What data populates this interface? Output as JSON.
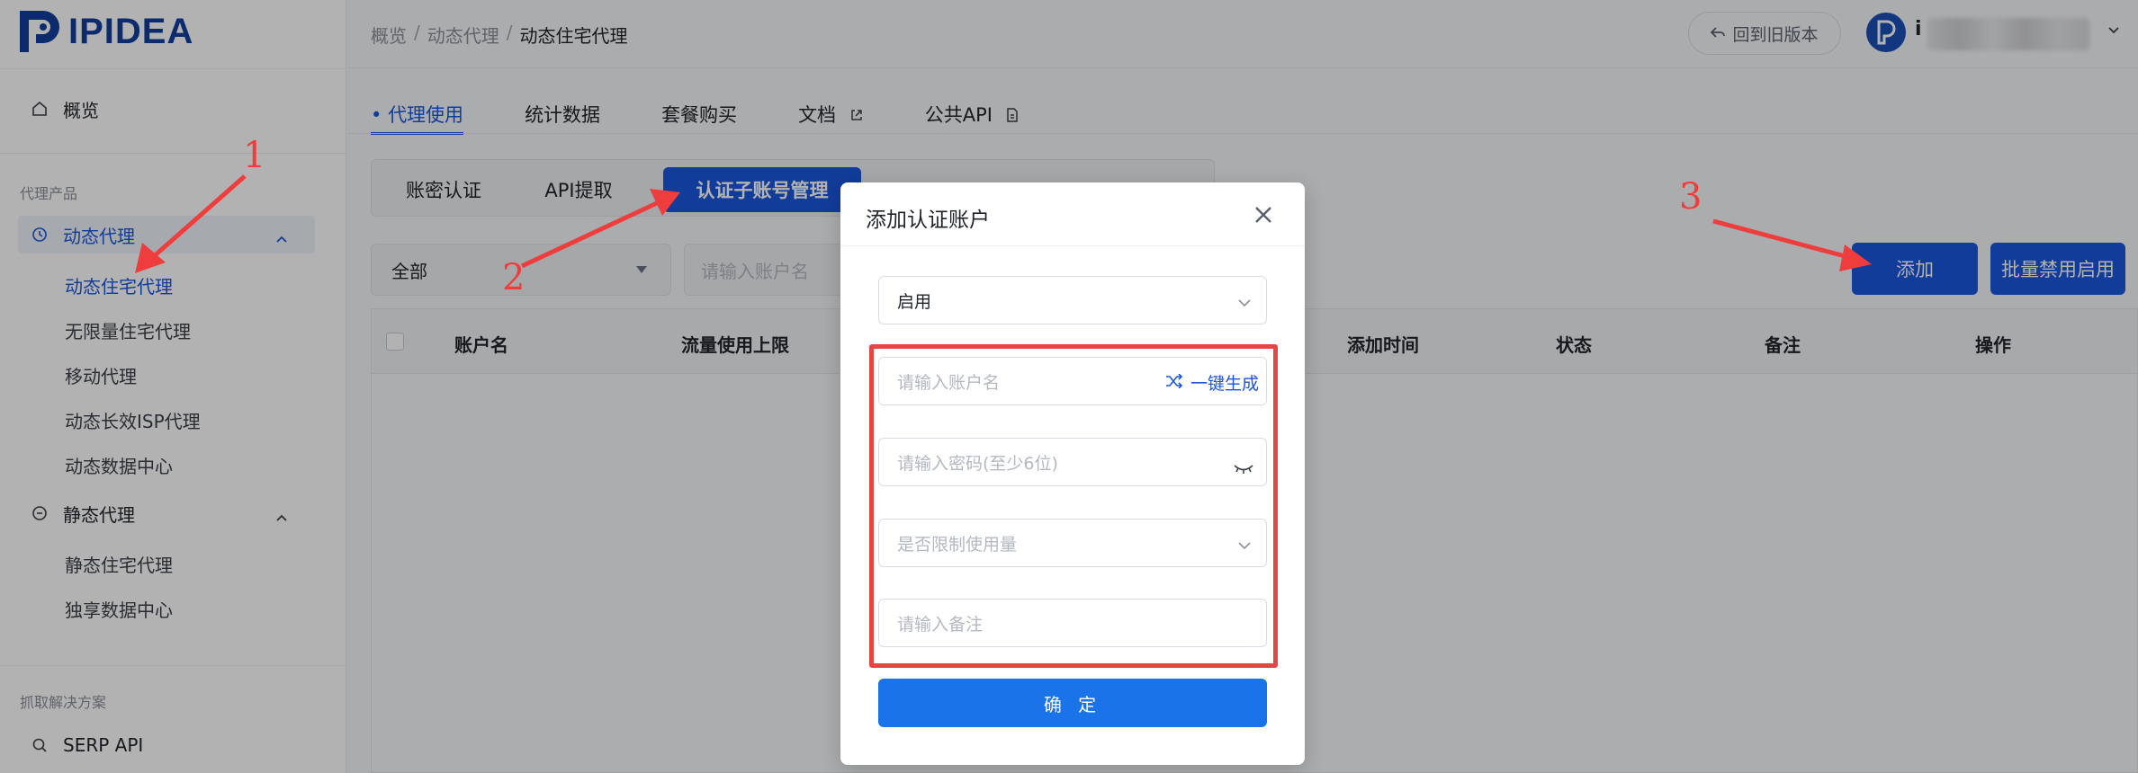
{
  "brand": {
    "name": "IPIDEA",
    "color": "#1a56db"
  },
  "sidebar": {
    "overview": {
      "label": "概览",
      "icon": "home-icon"
    },
    "section_proxy": "代理产品",
    "dynamic": {
      "label": "动态代理",
      "icon": "dynamic-proxy-icon"
    },
    "dynamic_items": [
      "动态住宅代理",
      "无限量住宅代理",
      "移动代理",
      "动态长效ISP代理",
      "动态数据中心"
    ],
    "static": {
      "label": "静态代理",
      "icon": "static-proxy-icon"
    },
    "static_items": [
      "静态住宅代理",
      "独享数据中心"
    ],
    "section_scrape": "抓取解决方案",
    "serp": {
      "label": "SERP API",
      "icon": "search-icon"
    }
  },
  "header": {
    "breadcrumb": [
      "概览",
      "动态代理",
      "动态住宅代理"
    ],
    "old_version_label": "回到旧版本",
    "user_initial": "i"
  },
  "tabs": [
    {
      "label": "代理使用",
      "active": true
    },
    {
      "label": "统计数据"
    },
    {
      "label": "套餐购买"
    },
    {
      "label": "文档",
      "icon": "external-link-icon"
    },
    {
      "label": "公共API",
      "icon": "document-icon"
    }
  ],
  "subtabs": [
    "账密认证",
    "API提取",
    "认证子账号管理",
    "",
    ""
  ],
  "filters": {
    "status_value": "全部",
    "account_placeholder": "请输入账户名"
  },
  "actions": {
    "add": "添加",
    "batch": "批量禁用启用"
  },
  "table": {
    "columns": [
      "账户名",
      "流量使用上限",
      "添加时间",
      "状态",
      "备注",
      "操作"
    ]
  },
  "modal": {
    "title": "添加认证账户",
    "status_value": "启用",
    "account_placeholder": "请输入账户名",
    "generate_label": "一键生成",
    "password_placeholder": "请输入密码(至少6位)",
    "limit_placeholder": "是否限制使用量",
    "remark_placeholder": "请输入备注",
    "confirm_label": "确 定"
  },
  "annotations": [
    "1",
    "2",
    "3"
  ]
}
